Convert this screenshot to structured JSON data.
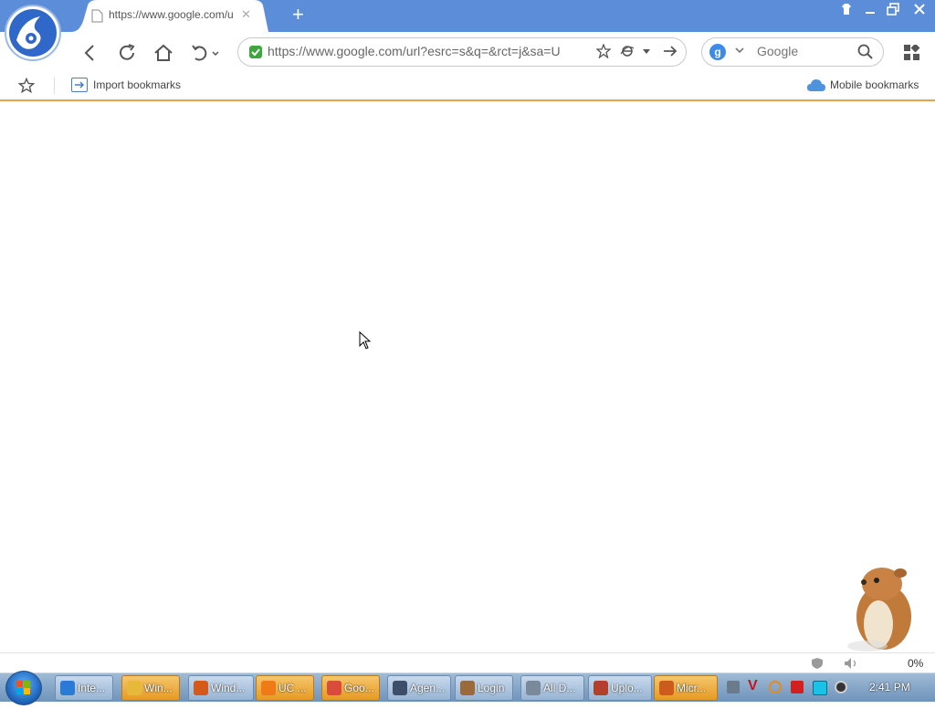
{
  "browser": {
    "tab": {
      "title": "https://www.google.com/u"
    },
    "address": {
      "url": "https://www.google.com/url?esrc=s&q=&rct=j&sa=U&u"
    },
    "search": {
      "placeholder": "Google",
      "engine_letter": "g"
    },
    "bookmarks": {
      "import_label": "Import bookmarks",
      "mobile_label": "Mobile bookmarks"
    },
    "status": {
      "zoom_text": "0%"
    }
  },
  "taskbar": {
    "items": [
      {
        "label": "Inte...",
        "icon": "ie-icon",
        "color": "#2a7bd6"
      },
      {
        "label": "Win...",
        "icon": "folder-icon",
        "color": "#e7b93a"
      },
      {
        "label": "Wind...",
        "icon": "media-player-icon",
        "color": "#d35a1a"
      },
      {
        "label": "UC ...",
        "icon": "uc-browser-icon",
        "color": "#f07a16"
      },
      {
        "label": "Goo...",
        "icon": "chrome-icon",
        "color": "#d94b3b"
      },
      {
        "label": "Agen...",
        "icon": "agent-icon",
        "color": "#3c4e6a"
      },
      {
        "label": "Login",
        "icon": "gopher-icon",
        "color": "#9a6a3a"
      },
      {
        "label": "All D...",
        "icon": "document-icon",
        "color": "#7a8a9a"
      },
      {
        "label": "Uplo...",
        "icon": "upload-icon",
        "color": "#b3402a"
      },
      {
        "label": "Micr...",
        "icon": "office-icon",
        "color": "#cc5b1d"
      }
    ],
    "clock": "2:41 PM"
  }
}
